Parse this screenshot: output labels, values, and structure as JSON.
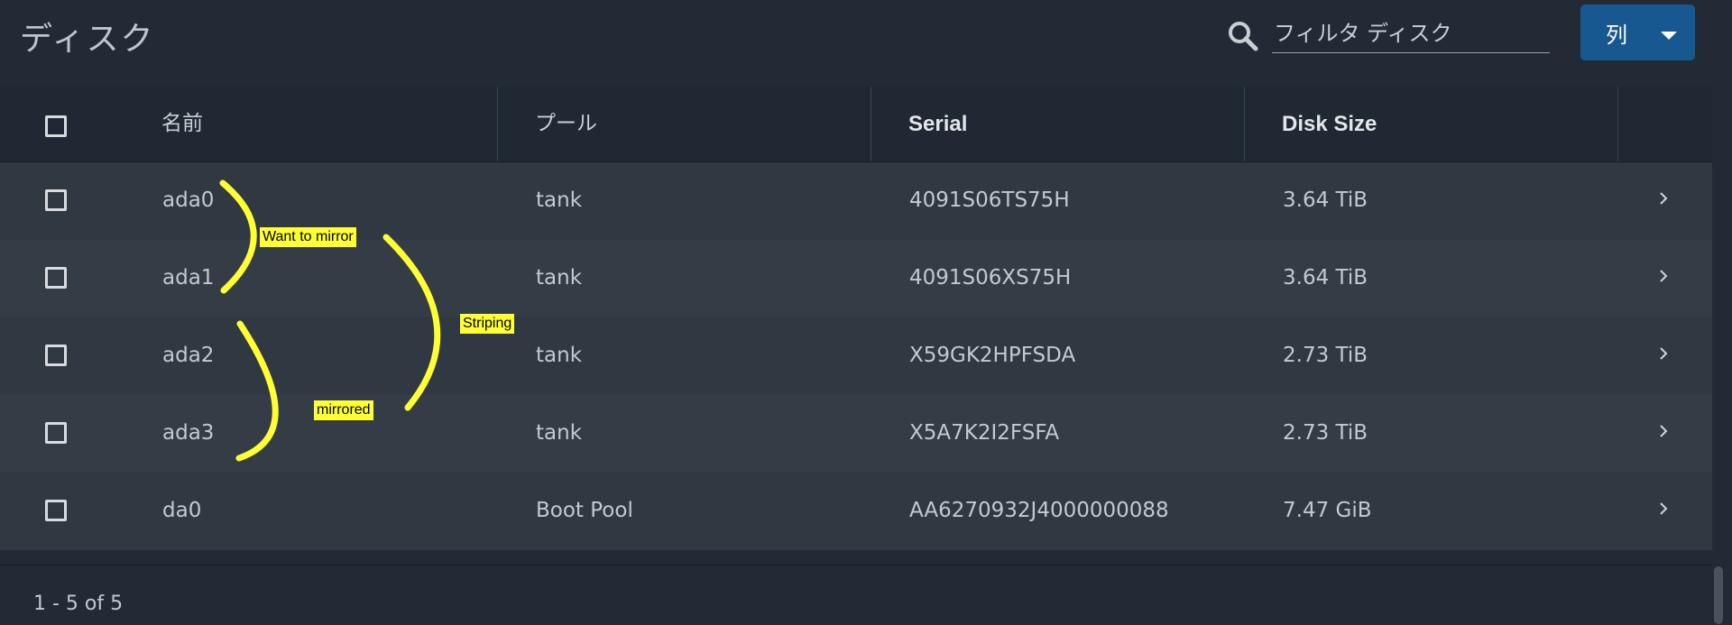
{
  "header": {
    "title": "ディスク",
    "search_icon": "search-icon",
    "filter_placeholder": "フィルタ ディスク",
    "columns_button": "列"
  },
  "table": {
    "columns": [
      "名前",
      "プール",
      "Serial",
      "Disk Size"
    ],
    "rows": [
      {
        "name": "ada0",
        "pool": "tank",
        "serial": "4091S06TS75H",
        "size": "3.64 TiB"
      },
      {
        "name": "ada1",
        "pool": "tank",
        "serial": "4091S06XS75H",
        "size": "3.64 TiB"
      },
      {
        "name": "ada2",
        "pool": "tank",
        "serial": "X59GK2HPFSDA",
        "size": "2.73 TiB"
      },
      {
        "name": "ada3",
        "pool": "tank",
        "serial": "X5A7K2I2FSFA",
        "size": "2.73 TiB"
      },
      {
        "name": "da0",
        "pool": "Boot Pool",
        "serial": "AA6270932J4000000088",
        "size": "7.47 GiB"
      }
    ]
  },
  "annotations": {
    "want_to_mirror": "Want to mirror",
    "striping": "Striping",
    "mirrored": "mirrored",
    "color": "#ffff33"
  },
  "footer": {
    "pagination": "1 - 5 of 5"
  },
  "colors": {
    "background": "#222a35",
    "accent": "#16588f"
  }
}
